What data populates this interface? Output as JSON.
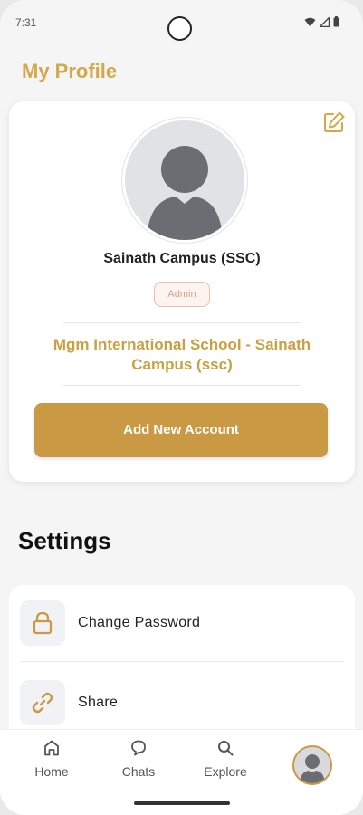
{
  "status_bar": {
    "time": "7:31"
  },
  "page": {
    "title": "My Profile"
  },
  "profile": {
    "name": "Sainath Campus (SSC)",
    "role": "Admin",
    "school": "Mgm International School - Sainath Campus (ssc)",
    "add_account_label": "Add New Account"
  },
  "settings": {
    "heading": "Settings",
    "items": [
      {
        "label": "Change Password",
        "icon": "lock-icon"
      },
      {
        "label": "Share",
        "icon": "link-icon"
      }
    ]
  },
  "bottom_nav": {
    "items": [
      {
        "label": "Home",
        "icon": "home-icon"
      },
      {
        "label": "Chats",
        "icon": "chat-icon"
      },
      {
        "label": "Explore",
        "icon": "search-icon"
      }
    ],
    "profile_icon": "avatar"
  },
  "colors": {
    "accent": "#c99a43",
    "title": "#d4a84b",
    "badge_border": "#e9bfb0",
    "background": "#f5f5f5"
  }
}
